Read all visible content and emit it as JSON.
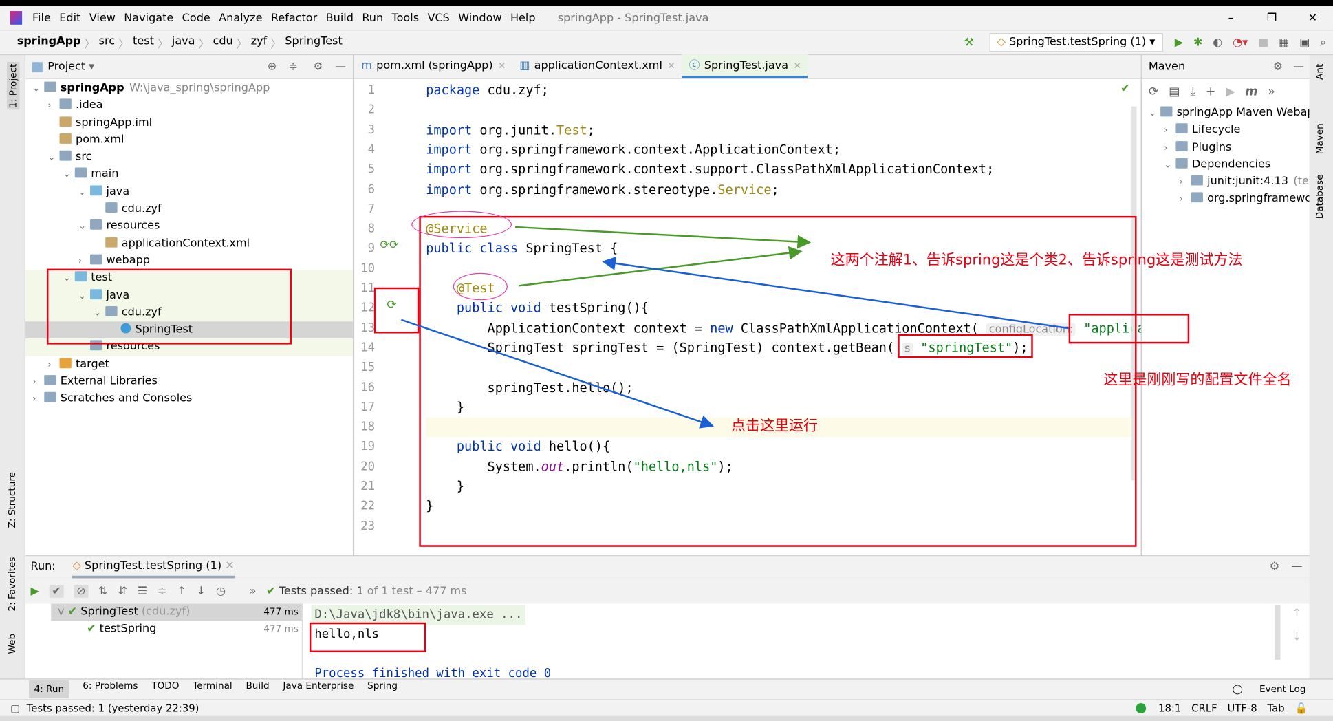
{
  "window": {
    "title": "springApp - SpringTest.java",
    "menu": [
      "File",
      "Edit",
      "View",
      "Navigate",
      "Code",
      "Analyze",
      "Refactor",
      "Build",
      "Run",
      "Tools",
      "VCS",
      "Window",
      "Help"
    ],
    "controls": [
      "–",
      "❐",
      "✕"
    ]
  },
  "breadcrumb": [
    "springApp",
    "src",
    "test",
    "java",
    "cdu",
    "zyf",
    "SpringTest"
  ],
  "run_config": "SpringTest.testSpring (1)",
  "project": {
    "header": "Project",
    "tree": [
      {
        "label": "springApp",
        "extra": "W:\\java_spring\\springApp",
        "depth": 0,
        "arrow": "v",
        "bold": true
      },
      {
        "label": ".idea",
        "depth": 1,
        "arrow": ">"
      },
      {
        "label": "springApp.iml",
        "depth": 1,
        "arrow": ""
      },
      {
        "label": "pom.xml",
        "depth": 1,
        "arrow": ""
      },
      {
        "label": "src",
        "depth": 1,
        "arrow": "v"
      },
      {
        "label": "main",
        "depth": 2,
        "arrow": "v"
      },
      {
        "label": "java",
        "depth": 3,
        "arrow": "v"
      },
      {
        "label": "cdu.zyf",
        "depth": 4,
        "arrow": ""
      },
      {
        "label": "resources",
        "depth": 3,
        "arrow": "v"
      },
      {
        "label": "applicationContext.xml",
        "depth": 4,
        "arrow": ""
      },
      {
        "label": "webapp",
        "depth": 3,
        "arrow": ">"
      },
      {
        "label": "test",
        "depth": 2,
        "arrow": "v"
      },
      {
        "label": "java",
        "depth": 3,
        "arrow": "v"
      },
      {
        "label": "cdu.zyf",
        "depth": 4,
        "arrow": "v"
      },
      {
        "label": "SpringTest",
        "depth": 5,
        "arrow": "",
        "selected": true
      },
      {
        "label": "resources",
        "depth": 3,
        "arrow": ""
      },
      {
        "label": "target",
        "depth": 1,
        "arrow": ">"
      },
      {
        "label": "External Libraries",
        "depth": 0,
        "arrow": ">"
      },
      {
        "label": "Scratches and Consoles",
        "depth": 0,
        "arrow": ">"
      }
    ]
  },
  "editor": {
    "tabs": [
      {
        "label": "pom.xml (springApp)"
      },
      {
        "label": "applicationContext.xml"
      },
      {
        "label": "SpringTest.java",
        "active": true
      }
    ],
    "lines": [
      [
        [
          "package ",
          "kw"
        ],
        [
          "cdu.zyf;",
          ""
        ]
      ],
      [],
      [
        [
          "import ",
          "kw"
        ],
        [
          "org.junit.",
          ""
        ],
        [
          "Test",
          "cls"
        ],
        [
          ";",
          ""
        ]
      ],
      [
        [
          "import ",
          "kw"
        ],
        [
          "org.springframework.context.ApplicationContext;",
          ""
        ]
      ],
      [
        [
          "import ",
          "kw"
        ],
        [
          "org.springframework.context.support.ClassPathXmlApplicationContext;",
          ""
        ]
      ],
      [
        [
          "import ",
          "kw"
        ],
        [
          "org.springframework.stereotype.",
          ""
        ],
        [
          "Service",
          "cls"
        ],
        [
          ";",
          ""
        ]
      ],
      [],
      [
        [
          "@Service",
          "ann"
        ]
      ],
      [
        [
          "public class ",
          "kw"
        ],
        [
          "SpringTest {",
          ""
        ]
      ],
      [],
      [
        [
          "    ",
          ""
        ],
        [
          "@Test",
          "ann"
        ]
      ],
      [
        [
          "    ",
          ""
        ],
        [
          "public void ",
          "kw"
        ],
        [
          "testSpring(){",
          ""
        ]
      ],
      [
        [
          "        ApplicationContext context = ",
          ""
        ],
        [
          "new ",
          "kw"
        ],
        [
          "ClassPathXmlApplicationContext( ",
          ""
        ],
        [
          "configLocation:",
          "hint"
        ],
        [
          " ",
          ""
        ],
        [
          "\"applicat",
          "str"
        ]
      ],
      [
        [
          "        SpringTest springTest = (SpringTest) context.getBean( ",
          ""
        ],
        [
          "s",
          "hint"
        ],
        [
          " ",
          ""
        ],
        [
          "\"springTest\"",
          "str"
        ],
        [
          ");",
          ""
        ]
      ],
      [],
      [
        [
          "        springTest.hello();",
          ""
        ]
      ],
      [
        [
          "    }",
          ""
        ]
      ],
      [],
      [
        [
          "    ",
          ""
        ],
        [
          "public void ",
          "kw"
        ],
        [
          "hello(){",
          ""
        ]
      ],
      [
        [
          "        System.",
          ""
        ],
        [
          "out",
          "it"
        ],
        [
          ".println(",
          ""
        ],
        [
          "\"hello,nls\"",
          "str"
        ],
        [
          ");",
          ""
        ]
      ],
      [
        [
          "    }",
          ""
        ]
      ],
      [
        [
          "}",
          ""
        ]
      ],
      []
    ]
  },
  "maven": {
    "header": "Maven",
    "tree": [
      {
        "label": "springApp Maven Webapp",
        "depth": 0,
        "arrow": "v"
      },
      {
        "label": "Lifecycle",
        "depth": 1,
        "arrow": ">"
      },
      {
        "label": "Plugins",
        "depth": 1,
        "arrow": ">"
      },
      {
        "label": "Dependencies",
        "depth": 1,
        "arrow": "v"
      },
      {
        "label": "junit:junit:4.13",
        "extra": "(test)",
        "depth": 2,
        "arrow": ">"
      },
      {
        "label": "org.springframewor",
        "depth": 2,
        "arrow": ">"
      }
    ]
  },
  "run": {
    "label": "Run:",
    "tab": "SpringTest.testSpring (1)",
    "status_prefix": "Tests passed:",
    "status_count": "1",
    "status_rest": "of 1 test – 477 ms",
    "tests": [
      {
        "name": "SpringTest",
        "pkg": "(cdu.zyf)",
        "time": "477 ms"
      },
      {
        "name": "testSpring",
        "time": "477 ms"
      }
    ],
    "console": [
      "D:\\Java\\jdk8\\bin\\java.exe ...",
      "hello,nls",
      "",
      "Process finished with exit code 0"
    ]
  },
  "toolwindows": [
    "4: Run",
    "6: Problems",
    "TODO",
    "Terminal",
    "Build",
    "Java Enterprise",
    "Spring"
  ],
  "event_log": "Event Log",
  "statusbar": {
    "message": "Tests passed: 1 (yesterday 22:39)",
    "position": "18:1",
    "line_sep": "CRLF",
    "encoding": "UTF-8",
    "indent": "Tab"
  },
  "side_labels": {
    "project": "1: Project",
    "structure": "Z: Structure",
    "favorites": "2: Favorites",
    "web": "Web",
    "ant": "Ant",
    "maven": "Maven",
    "database": "Database"
  },
  "annotations": {
    "two_annotations": "这两个注解1、告诉spring这是个类2、告诉spring这是测试方法",
    "config_file": "这里是刚刚写的配置文件全名",
    "click_run": "点击这里运行"
  },
  "colors": {
    "annotation_red": "#e60012",
    "arrow_green": "#4a9a2a",
    "arrow_blue": "#1b5fd6",
    "keyword": "#0033b3",
    "string": "#067d17"
  }
}
